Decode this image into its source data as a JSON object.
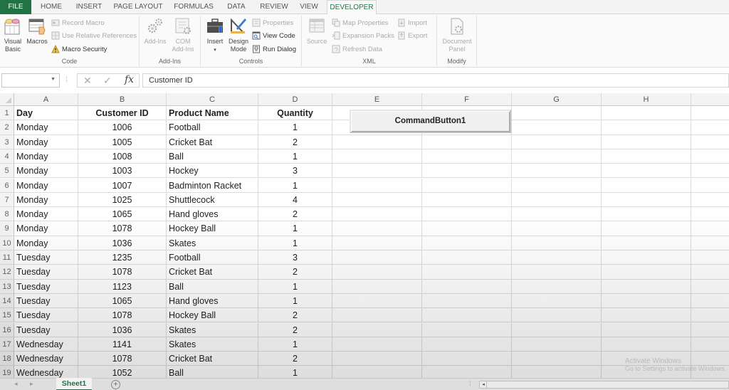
{
  "tabs": [
    {
      "label": "FILE"
    },
    {
      "label": "HOME"
    },
    {
      "label": "INSERT"
    },
    {
      "label": "PAGE LAYOUT"
    },
    {
      "label": "FORMULAS"
    },
    {
      "label": "DATA"
    },
    {
      "label": "REVIEW"
    },
    {
      "label": "VIEW"
    },
    {
      "label": "DEVELOPER"
    }
  ],
  "ribbon": {
    "code": {
      "label": "Code",
      "visual_basic": "Visual\nBasic",
      "visual_basic_l1": "Visual",
      "visual_basic_l2": "Basic",
      "macros": "Macros",
      "record_macro": "Record Macro",
      "use_relative": "Use Relative References",
      "macro_security": "Macro Security"
    },
    "addins": {
      "label": "Add-Ins",
      "addins_btn": "Add-Ins",
      "com_l1": "COM",
      "com_l2": "Add-Ins"
    },
    "controls": {
      "label": "Controls",
      "insert": "Insert",
      "design_l1": "Design",
      "design_l2": "Mode",
      "properties": "Properties",
      "view_code": "View Code",
      "run_dialog": "Run Dialog"
    },
    "xml": {
      "label": "XML",
      "source": "Source",
      "map_properties": "Map Properties",
      "expansion_packs": "Expansion Packs",
      "refresh_data": "Refresh Data",
      "import": "Import",
      "export": "Export"
    },
    "modify": {
      "label": "Modify",
      "doc_l1": "Document",
      "doc_l2": "Panel"
    }
  },
  "formula_bar": {
    "name_box": "",
    "cancel_glyph": "✕",
    "enter_glyph": "✓",
    "fx_label": "fx",
    "content": "Customer ID"
  },
  "columns": [
    "A",
    "B",
    "C",
    "D",
    "E",
    "F",
    "G",
    "H"
  ],
  "header_row": {
    "row": "1",
    "day": "Day",
    "customer_id": "Customer ID",
    "product": "Product Name",
    "quantity": "Quantity"
  },
  "rows": [
    {
      "row": "2",
      "day": "Monday",
      "customer_id": "1006",
      "product": "Football",
      "quantity": "1"
    },
    {
      "row": "3",
      "day": "Monday",
      "customer_id": "1005",
      "product": "Cricket Bat",
      "quantity": "2"
    },
    {
      "row": "4",
      "day": "Monday",
      "customer_id": "1008",
      "product": "Ball",
      "quantity": "1"
    },
    {
      "row": "5",
      "day": "Monday",
      "customer_id": "1003",
      "product": "Hockey",
      "quantity": "3"
    },
    {
      "row": "6",
      "day": "Monday",
      "customer_id": "1007",
      "product": "Badminton Racket",
      "quantity": "1"
    },
    {
      "row": "7",
      "day": "Monday",
      "customer_id": "1025",
      "product": "Shuttlecock",
      "quantity": "4"
    },
    {
      "row": "8",
      "day": "Monday",
      "customer_id": "1065",
      "product": "Hand gloves",
      "quantity": "2"
    },
    {
      "row": "9",
      "day": "Monday",
      "customer_id": "1078",
      "product": "Hockey Ball",
      "quantity": "1"
    },
    {
      "row": "10",
      "day": "Monday",
      "customer_id": "1036",
      "product": "Skates",
      "quantity": "1"
    },
    {
      "row": "11",
      "day": "Tuesday",
      "customer_id": "1235",
      "product": "Football",
      "quantity": "3"
    },
    {
      "row": "12",
      "day": "Tuesday",
      "customer_id": "1078",
      "product": "Cricket Bat",
      "quantity": "2"
    },
    {
      "row": "13",
      "day": "Tuesday",
      "customer_id": "1123",
      "product": "Ball",
      "quantity": "1"
    },
    {
      "row": "14",
      "day": "Tuesday",
      "customer_id": "1065",
      "product": "Hand gloves",
      "quantity": "1"
    },
    {
      "row": "15",
      "day": "Tuesday",
      "customer_id": "1078",
      "product": "Hockey Ball",
      "quantity": "2"
    },
    {
      "row": "16",
      "day": "Tuesday",
      "customer_id": "1036",
      "product": "Skates",
      "quantity": "2"
    },
    {
      "row": "17",
      "day": "Wednesday",
      "customer_id": "1141",
      "product": "Skates",
      "quantity": "1"
    },
    {
      "row": "18",
      "day": "Wednesday",
      "customer_id": "1078",
      "product": "Cricket Bat",
      "quantity": "2"
    },
    {
      "row": "19",
      "day": "Wednesday",
      "customer_id": "1052",
      "product": "Ball",
      "quantity": "1"
    }
  ],
  "command_button": {
    "label": "CommandButton1"
  },
  "sheets": [
    {
      "label": "Sheet1",
      "active": true
    }
  ],
  "add_sheet_glyph": "+",
  "watermark": {
    "line1": "Activate Windows",
    "line2": "Go to Settings to activate Windows."
  },
  "colors": {
    "accent": "#217346"
  }
}
